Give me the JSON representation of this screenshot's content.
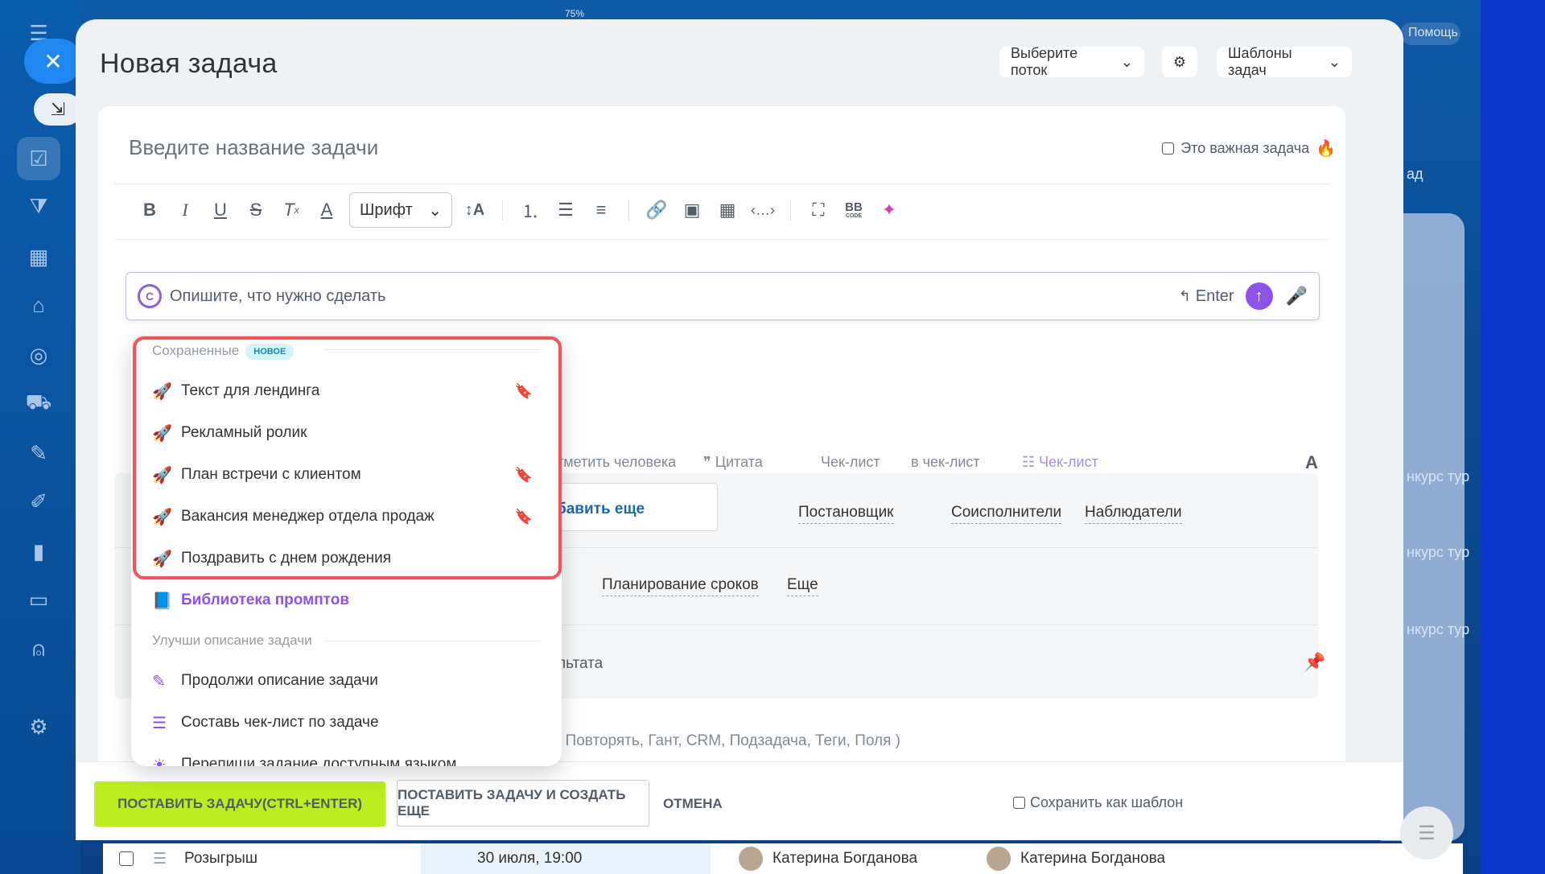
{
  "zoom": "75%",
  "help_label": "Помощь",
  "modal": {
    "title": "Новая задача",
    "stream_select": "Выберите поток",
    "templates_button": "Шаблоны задач"
  },
  "task": {
    "title_placeholder": "Введите название задачи",
    "important_label": "Это важная задача"
  },
  "editor": {
    "font_label": "Шрифт",
    "bbcode_label": "BB",
    "bbcode_sub": "CODE"
  },
  "ai": {
    "placeholder": "Опишите, что нужно сделать",
    "enter_label": "Enter"
  },
  "menu": {
    "saved_section": "Сохраненные",
    "new_badge": "НОВОЕ",
    "saved_items": [
      {
        "label": "Текст для лендинга"
      },
      {
        "label": "Рекламный ролик"
      },
      {
        "label": "План встречи с клиентом"
      },
      {
        "label": "Вакансия менеджер отдела продаж"
      },
      {
        "label": "Поздравить с днем рождения"
      }
    ],
    "library_label": "Библиотека промптов",
    "improve_section": "Улучши описание задачи",
    "improve_items": [
      {
        "label": "Продолжи описание задачи"
      },
      {
        "label": "Составь чек-лист по задаче"
      },
      {
        "label": "Перепиши задание доступным языком"
      }
    ]
  },
  "form": {
    "mention": "тметить человека",
    "quote": "Цитата",
    "checklist": "Чек-лист",
    "to_checklist": "в чек-лист",
    "checklist2": "Чек-лист",
    "add_more": "бавить еще",
    "creator": "Постановщик",
    "coexecutors": "Соисполнители",
    "observers": "Наблюдатели",
    "planning": "Планирование сроков",
    "more": "Еще",
    "result": "льтата",
    "extras": ",  Повторять,  Гант,  CRM,  Подзадача,  Теги,  Поля )"
  },
  "bottom": {
    "submit": "ПОСТАВИТЬ ЗАДАЧУ(CTRL+ENTER)",
    "submit_more": "ПОСТАВИТЬ ЗАДАЧУ И СОЗДАТЬ ЕЩЕ",
    "cancel": "ОТМЕНА",
    "save_template": "Сохранить как шаблон"
  },
  "background_list": {
    "row_name": "Розыгрыш",
    "row_date": "30 июля, 19:00",
    "person1": "Катерина Богданова",
    "person2": "Катерина Богданова",
    "side_text": "нкурс тур",
    "side_text2": "ад"
  }
}
